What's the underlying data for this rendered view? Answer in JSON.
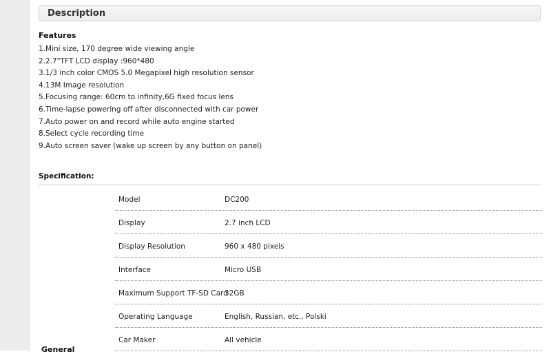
{
  "description": {
    "title": "Description"
  },
  "features": {
    "title": "Features",
    "items": [
      "1.Mini size, 170 degree wide viewing angle",
      "2.2.7\"TFT LCD display :960*480",
      "3.1/3 inch color CMOS 5.0 Megapixel high resolution sensor",
      "4.13M Image resolution",
      "5.Focusing range: 60cm to infinity,6G fixed focus lens",
      "6.Time-lapse powering off after disconnected with car power",
      "7.Auto power on and record while auto engine started",
      "8.Select cycle recording time",
      "9.Auto screen saver (wake up screen by any button on panel)"
    ]
  },
  "specification": {
    "title": "Specification:",
    "rows": [
      {
        "key": "Model",
        "value": "DC200"
      },
      {
        "key": "Display",
        "value": "2.7 inch LCD"
      },
      {
        "key": "Display Resolution",
        "value": "960 x 480 pixels"
      },
      {
        "key": "Interface",
        "value": "Micro USB"
      },
      {
        "key": "Maximum Support TF-SD Card",
        "value": "32GB"
      },
      {
        "key": "Operating Language",
        "value": "English, Russian, etc., Polski"
      },
      {
        "key": "Car Maker",
        "value": "All vehicle"
      }
    ],
    "group_label": "General"
  }
}
